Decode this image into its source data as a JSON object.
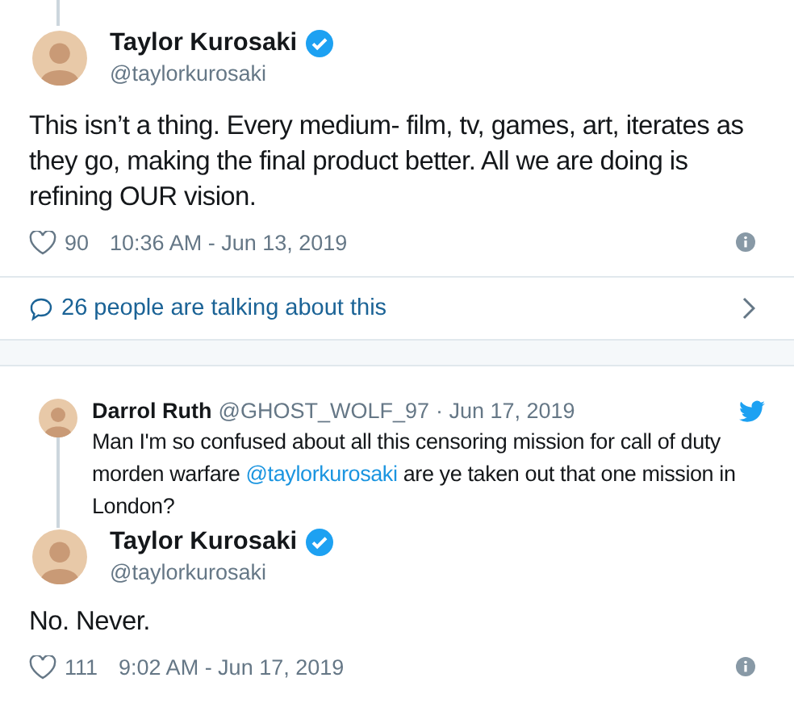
{
  "thread": [
    {
      "kind": "focus",
      "author": "Taylor Kurosaki",
      "verified": true,
      "handle": "@taylorkurosaki",
      "line_above": true,
      "body": [
        {
          "kind": "text",
          "text": "This isn’t a thing. Every medium- film, tv, games, art, iterates as they go, making the final product better. All we are doing is refining OUR vision."
        }
      ],
      "likes": "90",
      "timestamp": "10:36 AM - Jun 13, 2019"
    },
    {
      "kind": "conversation",
      "text": "26 people are talking about this"
    },
    {
      "kind": "reply",
      "author": "Darrol Ruth",
      "handle": "@GHOST_WOLF_97",
      "date": "· Jun 17, 2019",
      "line_below": true,
      "body": [
        {
          "kind": "text",
          "text": "Man I'm so confused about all this censoring mission for call of duty morden warfare "
        },
        {
          "kind": "mention",
          "text": "@taylorkurosaki"
        },
        {
          "kind": "text",
          "text": " are ye taken out that one mission in London?"
        }
      ]
    },
    {
      "kind": "focus",
      "author": "Taylor Kurosaki",
      "verified": true,
      "handle": "@taylorkurosaki",
      "line_above": false,
      "body": [
        {
          "kind": "text",
          "text": "No. Never."
        }
      ],
      "likes": "111",
      "timestamp": "9:02 AM - Jun 17, 2019"
    }
  ]
}
